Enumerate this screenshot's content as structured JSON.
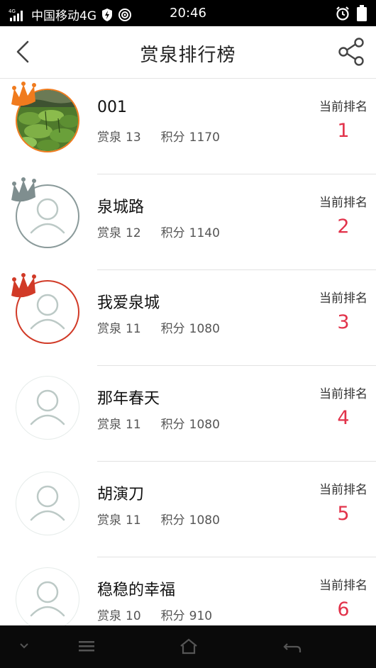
{
  "status_bar": {
    "network_tag": "4G",
    "carrier": "中国移动4G",
    "time": "20:46",
    "icons": [
      "signal-icon",
      "shield-bolt-icon",
      "hotspot-icon",
      "alarm-icon",
      "battery-icon"
    ]
  },
  "nav": {
    "title": "赏泉排行榜",
    "back_icon": "chevron-left-icon",
    "share_icon": "share-icon"
  },
  "labels": {
    "springs": "赏泉",
    "points": "积分",
    "current_rank": "当前排名"
  },
  "colors": {
    "rank_red": "#e2324a",
    "crown_gold": "#f07b1e",
    "crown_silver": "#7f8e8f",
    "crown_bronze": "#d13a27"
  },
  "ranking": [
    {
      "name": "001",
      "springs": "13",
      "points": "1170",
      "rank": "1"
    },
    {
      "name": "泉城路",
      "springs": "12",
      "points": "1140",
      "rank": "2"
    },
    {
      "name": "我爱泉城",
      "springs": "11",
      "points": "1080",
      "rank": "3"
    },
    {
      "name": "那年春天",
      "springs": "11",
      "points": "1080",
      "rank": "4"
    },
    {
      "name": "胡演刀",
      "springs": "11",
      "points": "1080",
      "rank": "5"
    },
    {
      "name": "稳稳的幸福",
      "springs": "10",
      "points": "910",
      "rank": "6"
    }
  ],
  "bottom_nav": {
    "icons": [
      "chevron-down-icon",
      "menu-icon",
      "home-icon",
      "back-arrow-icon"
    ]
  }
}
